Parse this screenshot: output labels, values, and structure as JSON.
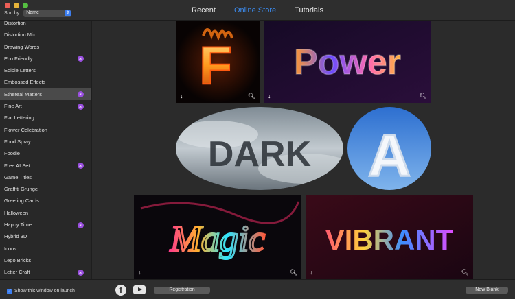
{
  "header": {
    "tabs": [
      "Recent",
      "Online Store",
      "Tutorials"
    ],
    "active_tab": "Online Store",
    "sort_label": "Sort by",
    "sort_value": "Name"
  },
  "sidebar": {
    "items": [
      {
        "label": "Distortion",
        "ai": false
      },
      {
        "label": "Distortion Mix",
        "ai": false
      },
      {
        "label": "Drawing Words",
        "ai": false
      },
      {
        "label": "Eco Friendly",
        "ai": true
      },
      {
        "label": "Edible Letters",
        "ai": false
      },
      {
        "label": "Embossed Effects",
        "ai": false
      },
      {
        "label": "Ethereal Matters",
        "ai": true,
        "selected": true
      },
      {
        "label": "Fine Art",
        "ai": true
      },
      {
        "label": "Flat Lettering",
        "ai": false
      },
      {
        "label": "Flower Celebration",
        "ai": false
      },
      {
        "label": "Food Spray",
        "ai": false
      },
      {
        "label": "Foodie",
        "ai": false
      },
      {
        "label": "Free AI Set",
        "ai": true
      },
      {
        "label": "Game Titles",
        "ai": false
      },
      {
        "label": "Graffiti Grunge",
        "ai": false
      },
      {
        "label": "Greeting Cards",
        "ai": false
      },
      {
        "label": "Halloween",
        "ai": false
      },
      {
        "label": "Happy Time",
        "ai": true
      },
      {
        "label": "Hybrid 3D",
        "ai": false
      },
      {
        "label": "Icons",
        "ai": false
      },
      {
        "label": "Lego Bricks",
        "ai": false
      },
      {
        "label": "Letter Craft",
        "ai": true
      }
    ],
    "ai_badge": "AI"
  },
  "gallery": {
    "tiles": [
      {
        "text": "F"
      },
      {
        "text": "Power"
      },
      {
        "text": "DARK"
      },
      {
        "text": "A"
      },
      {
        "text": "Magic"
      },
      {
        "text": "VIBRANT"
      }
    ]
  },
  "footer": {
    "show_on_launch_label": "Show this window on launch",
    "show_on_launch_checked": true,
    "registration_label": "Registration",
    "new_blank_label": "New Blank"
  },
  "icons": [
    "download-icon",
    "zoom-icon",
    "facebook-icon",
    "youtube-icon",
    "chevron-updown-icon",
    "checkmark-icon"
  ]
}
